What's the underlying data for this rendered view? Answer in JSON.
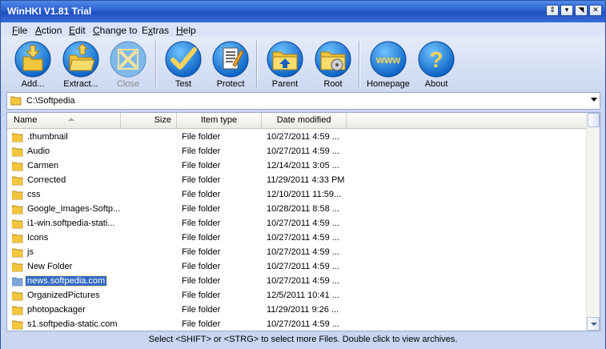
{
  "window": {
    "title": "WinHKI V1.81 Trial"
  },
  "menu": [
    {
      "pre": "",
      "ul": "F",
      "post": "ile"
    },
    {
      "pre": "",
      "ul": "A",
      "post": "ction"
    },
    {
      "pre": "",
      "ul": "E",
      "post": "dit"
    },
    {
      "pre": "",
      "ul": "C",
      "post": "hange to"
    },
    {
      "pre": "E",
      "ul": "x",
      "post": "tras"
    },
    {
      "pre": "",
      "ul": "H",
      "post": "elp"
    }
  ],
  "toolbar": {
    "add": "Add...",
    "extract": "Extract...",
    "close": "Close",
    "test": "Test",
    "protect": "Protect",
    "parent": "Parent",
    "root": "Root",
    "homepage": "Homepage",
    "homepage_icon_text": "www",
    "about": "About",
    "about_icon_text": "?"
  },
  "path": "C:\\Softpedia",
  "columns": {
    "name": "Name",
    "size": "Size",
    "type": "Item type",
    "date": "Date modified"
  },
  "files": [
    {
      "name": ".thumbnail",
      "type": "File folder",
      "date": "10/27/2011 4:59 ..."
    },
    {
      "name": "Audio",
      "type": "File folder",
      "date": "10/27/2011 4:59 ..."
    },
    {
      "name": "Carmen",
      "type": "File folder",
      "date": "12/14/2011 3:05 ..."
    },
    {
      "name": "Corrected",
      "type": "File folder",
      "date": "11/29/2011 4:33 PM"
    },
    {
      "name": "css",
      "type": "File folder",
      "date": "12/10/2011 11:59..."
    },
    {
      "name": "Google_Images-Softp...",
      "type": "File folder",
      "date": "10/28/2011 8:58 ..."
    },
    {
      "name": "i1-win.softpedia-stati...",
      "type": "File folder",
      "date": "10/27/2011 4:59 ..."
    },
    {
      "name": "Icons",
      "type": "File folder",
      "date": "10/27/2011 4:59 ..."
    },
    {
      "name": "js",
      "type": "File folder",
      "date": "10/27/2011 4:59 ..."
    },
    {
      "name": "New Folder",
      "type": "File folder",
      "date": "10/27/2011 4:59 ..."
    },
    {
      "name": "news.softpedia.com",
      "type": "File folder",
      "date": "10/27/2011 4:59 ...",
      "selected": true
    },
    {
      "name": "OrganizedPictures",
      "type": "File folder",
      "date": "12/5/2011 10:41 ..."
    },
    {
      "name": "photopackager",
      "type": "File folder",
      "date": "11/29/2011 9:26 ..."
    },
    {
      "name": "s1.softpedia-static.com",
      "type": "File folder",
      "date": "10/27/2011 4:59 ..."
    }
  ],
  "status": "Select <SHIFT> or <STRG> to select more Files. Double click to view archives.",
  "colors": {
    "title_bar": "#2a5fd0",
    "selection": "#316ac5",
    "folder": "#f2c53d",
    "icon_blue": "#1c7fd8"
  }
}
